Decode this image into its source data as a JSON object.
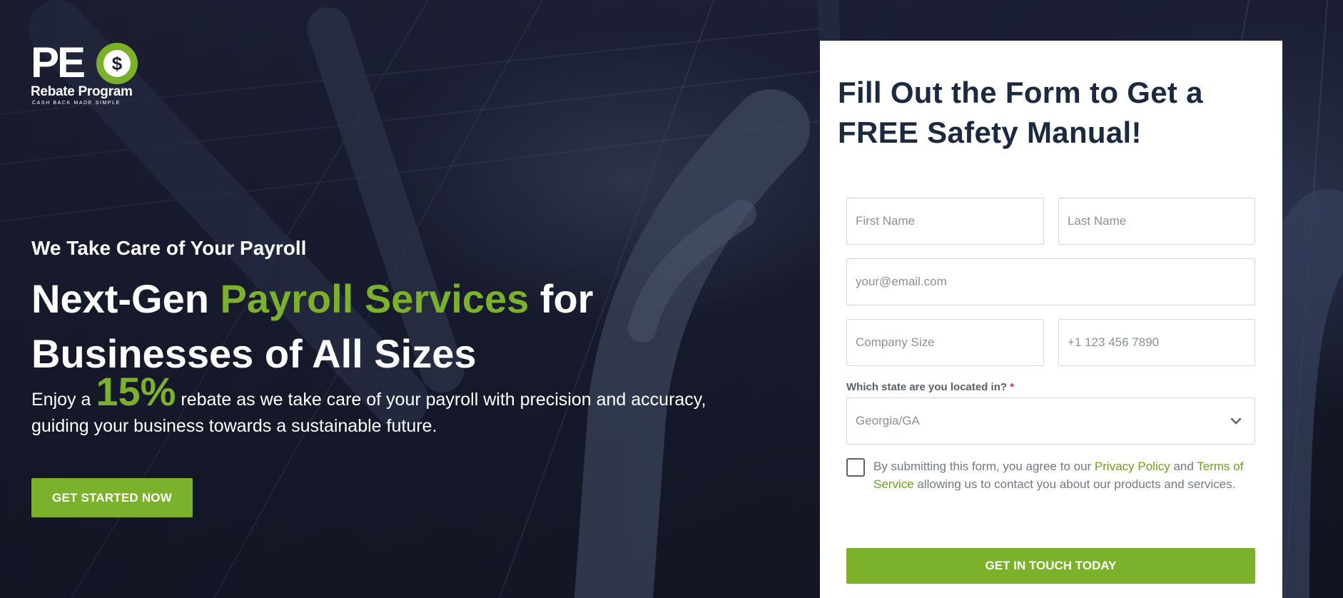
{
  "brand": {
    "logo_main": "PE",
    "logo_coin_symbol": "$",
    "logo_sub": "Rebate Program",
    "logo_tagline": "CASH BACK MADE SIMPLE",
    "accent_color": "#7cb22b"
  },
  "hero": {
    "kicker": "We Take Care of Your Payroll",
    "headline_part1": "Next-Gen ",
    "headline_accent": "Payroll Services",
    "headline_part2": " for Businesses of All Sizes",
    "lede_pre": "Enjoy a ",
    "lede_percent": "15%",
    "lede_post": " rebate as we take care of your payroll with precision and accuracy, guiding your business towards a sustainable future.",
    "cta_label": "GET STARTED NOW"
  },
  "form": {
    "title": "Fill Out the Form to Get a FREE Safety Manual!",
    "first_name_placeholder": "First Name",
    "last_name_placeholder": "Last Name",
    "email_placeholder": "your@email.com",
    "company_size_placeholder": "Company Size",
    "phone_placeholder": "+1 123 456 7890",
    "state_label": "Which state are you located in?",
    "required_mark": "*",
    "state_value": "Georgia/GA",
    "consent_pre": "By submitting this form, you agree to our ",
    "privacy_link": "Privacy Policy",
    "consent_and": " and ",
    "terms_link": "Terms of Service",
    "consent_post": " allowing us to contact you about our products and services.",
    "submit_label": "GET IN TOUCH TODAY"
  }
}
